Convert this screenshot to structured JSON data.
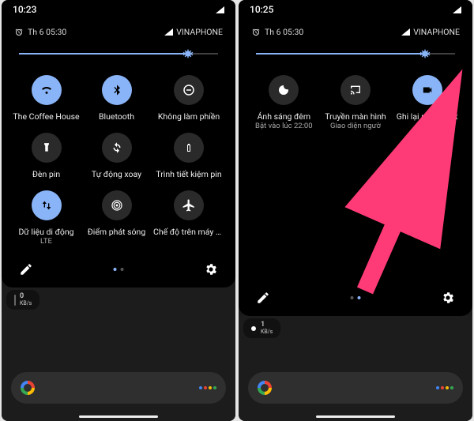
{
  "left": {
    "statusbar_time": "10:23",
    "alarm_text": "Th 6 05:30",
    "carrier": "VINAPHONE",
    "brightness_pct": 85,
    "tiles": [
      {
        "id": "wifi",
        "label": "The Coffee House",
        "sub": "",
        "on": true
      },
      {
        "id": "bluetooth",
        "label": "Bluetooth",
        "sub": "",
        "on": true
      },
      {
        "id": "dnd",
        "label": "Không làm phiền",
        "sub": "",
        "on": false
      },
      {
        "id": "flashlight",
        "label": "Đèn pin",
        "sub": "",
        "on": false
      },
      {
        "id": "autorotate",
        "label": "Tự động xoay",
        "sub": "",
        "on": false
      },
      {
        "id": "battery-saver",
        "label": "Trình tiết kiệm pin",
        "sub": "",
        "on": false
      },
      {
        "id": "mobile-data",
        "label": "Dữ liệu di động",
        "sub": "LTE",
        "on": true
      },
      {
        "id": "hotspot",
        "label": "Điểm phát sóng",
        "sub": "",
        "on": false
      },
      {
        "id": "airplane",
        "label": "Chế độ trên máy bay",
        "sub": "",
        "on": false
      }
    ],
    "page_index": 0,
    "page_count": 2,
    "speed_value": "0",
    "speed_unit": "KB/s"
  },
  "right": {
    "statusbar_time": "10:25",
    "alarm_text": "Th 6 05:30",
    "carrier": "VINAPHONE",
    "brightness_pct": 85,
    "tiles": [
      {
        "id": "night-light",
        "label": "Ánh sáng đêm",
        "sub": "Bật vào lúc 22:00",
        "on": false
      },
      {
        "id": "cast",
        "label": "Truyền màn hình",
        "sub": "Giao diện ngườ",
        "on": false
      },
      {
        "id": "screen-record",
        "label": "Ghi lại nội dung t",
        "sub": "Dừng",
        "on": true
      }
    ],
    "page_index": 1,
    "page_count": 2,
    "speed_value": "1",
    "speed_unit": "KB/s"
  },
  "icons": {
    "alarm": "alarm-icon",
    "signal": "signal-icon",
    "edit": "edit-icon",
    "settings": "gear-icon",
    "brightness_thumb": "gear-icon"
  }
}
